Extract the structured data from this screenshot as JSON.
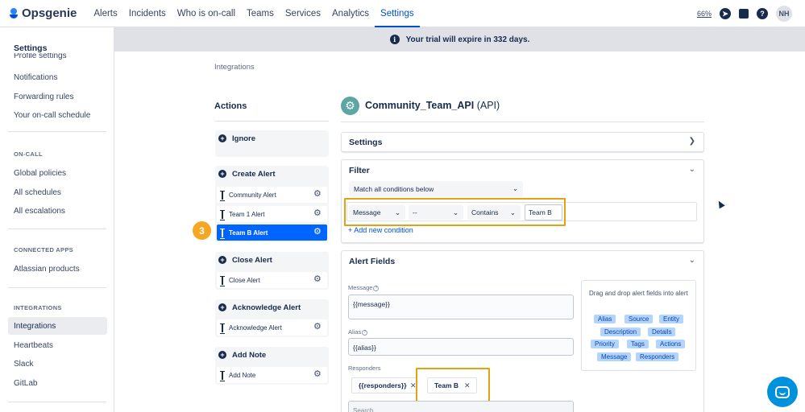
{
  "app": {
    "name": "Opsgenie",
    "nav": [
      "Alerts",
      "Incidents",
      "Who is on-call",
      "Teams",
      "Services",
      "Analytics",
      "Settings"
    ],
    "active_nav": "Settings",
    "zoom": "66%",
    "avatar_initials": "NH"
  },
  "sidebar": {
    "title": "Settings",
    "cut_item": "Profile settings",
    "items_top": [
      "Notifications",
      "Forwarding rules",
      "Your on-call schedule"
    ],
    "sections": [
      {
        "heading": "ON-CALL",
        "items": [
          "Global policies",
          "All schedules",
          "All escalations"
        ]
      },
      {
        "heading": "CONNECTED APPS",
        "items": [
          "Atlassian products"
        ]
      },
      {
        "heading": "INTEGRATIONS",
        "items": [
          "Integrations",
          "Heartbeats",
          "Slack",
          "GitLab"
        ]
      }
    ],
    "active_item": "Integrations"
  },
  "banner": {
    "text": "Your trial will expire in 332 days."
  },
  "breadcrumb": "Integrations",
  "actions": {
    "title": "Actions",
    "groups": [
      {
        "label": "Ignore",
        "subs": []
      },
      {
        "label": "Create Alert",
        "subs": [
          "Community Alert",
          "Team 1 Alert",
          "Team B Alert"
        ]
      },
      {
        "label": "Close Alert",
        "subs": [
          "Close Alert"
        ]
      },
      {
        "label": "Acknowledge Alert",
        "subs": [
          "Acknowledge Alert"
        ]
      },
      {
        "label": "Add Note",
        "subs": [
          "Add Note"
        ]
      }
    ],
    "selected": "Team B Alert",
    "step_number": "3"
  },
  "integration": {
    "name": "Community_Team_API",
    "type": "(API)"
  },
  "settings_card": {
    "title": "Settings"
  },
  "filter_card": {
    "title": "Filter",
    "match": "Match all conditions below",
    "condition": {
      "field": "Message",
      "not": "--",
      "operator": "Contains",
      "value": "Team B"
    },
    "add_condition": "+ Add new condition"
  },
  "alert_fields": {
    "title": "Alert Fields",
    "message_label": "Message",
    "message_value": "{{message}}",
    "alias_label": "Alias",
    "alias_value": "{{alias}}",
    "responders_label": "Responders",
    "responders": [
      "{{responders}}",
      "Team B"
    ],
    "search_placeholder": "Search..."
  },
  "drag_drop": {
    "hint": "Drag and drop alert fields into alert",
    "fields": [
      "Alias",
      "Source",
      "Entity",
      "Description",
      "Details",
      "Priority",
      "Tags",
      "Actions",
      "Message",
      "Responders"
    ]
  },
  "colors": {
    "brand": "#0052cc",
    "selected": "#0065ff",
    "highlight": "#e2a312",
    "badge": "#f5a623",
    "pill": "#b3d4ff"
  }
}
